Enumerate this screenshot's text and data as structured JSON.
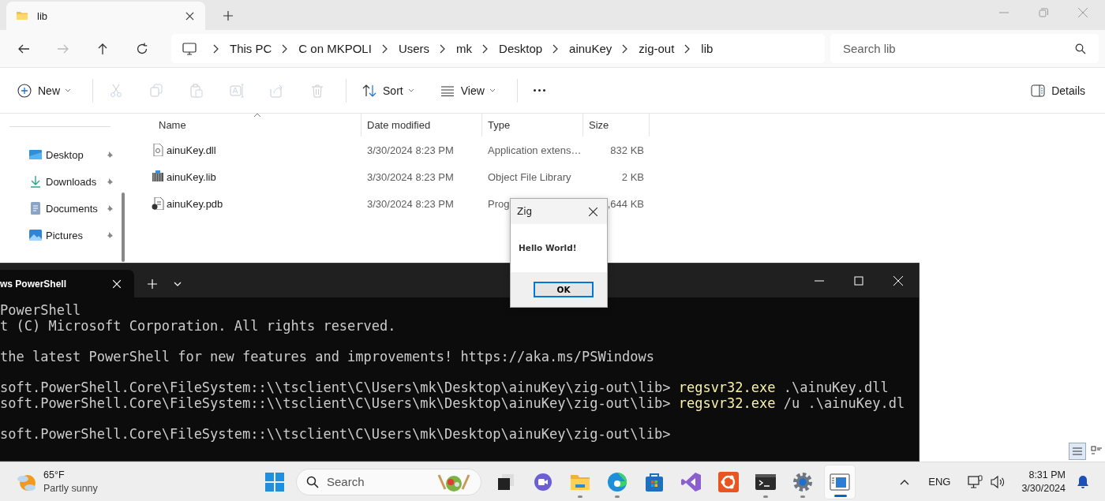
{
  "explorer": {
    "tab": {
      "title": "lib"
    },
    "breadcrumb": [
      "This PC",
      "C on MKPOLI",
      "Users",
      "mk",
      "Desktop",
      "ainuKey",
      "zig-out",
      "lib"
    ],
    "search": {
      "placeholder": "Search lib"
    },
    "toolbar": [
      {
        "kind": "new",
        "label": "New"
      }
    ],
    "edit_actions": [
      {
        "kind": "cut",
        "disabled": true
      },
      {
        "kind": "copy",
        "disabled": true
      },
      {
        "kind": "paste",
        "disabled": true
      },
      {
        "kind": "rename",
        "disabled": true
      },
      {
        "kind": "share",
        "disabled": true
      },
      {
        "kind": "delete",
        "disabled": true
      }
    ],
    "arrange_actions": [
      {
        "kind": "sort",
        "label": "Sort"
      },
      {
        "kind": "view",
        "label": "View"
      },
      {
        "kind": "more"
      }
    ],
    "details_button": "Details",
    "sidebar": [
      {
        "kind": "desktop",
        "label": "Desktop"
      },
      {
        "kind": "downloads",
        "label": "Downloads"
      },
      {
        "kind": "documents",
        "label": "Documents"
      },
      {
        "kind": "pictures",
        "label": "Pictures"
      }
    ],
    "columns": [
      "Name",
      "Date modified",
      "Type",
      "Size"
    ],
    "files": [
      {
        "kind": "dll",
        "name": "ainuKey.dll",
        "date": "3/30/2024 8:23 PM",
        "type": "Application extens…",
        "size": "832 KB"
      },
      {
        "kind": "lib",
        "name": "ainuKey.lib",
        "date": "3/30/2024 8:23 PM",
        "type": "Object File Library",
        "size": "2 KB"
      },
      {
        "kind": "pdb",
        "name": "ainuKey.pdb",
        "date": "3/30/2024 8:23 PM",
        "type": "Prog",
        "size": ",644 KB"
      }
    ],
    "view_modes": [
      {
        "kind": "details",
        "selected": true
      },
      {
        "kind": "tiles",
        "selected": false
      }
    ]
  },
  "terminal": {
    "tab": "ws PowerShell",
    "lines": [
      {
        "kind": "text",
        "text": "PowerShell"
      },
      {
        "kind": "text",
        "text": "t (C) Microsoft Corporation. All rights reserved."
      },
      {
        "kind": "blank"
      },
      {
        "kind": "text",
        "text": "the latest PowerShell for new features and improvements! https://aka.ms/PSWindows"
      },
      {
        "kind": "blank"
      },
      {
        "kind": "command",
        "prompt": "soft.PowerShell.Core\\FileSystem::\\\\tsclient\\C\\Users\\mk\\Desktop\\ainuKey\\zig-out\\lib>",
        "command": "regsvr32.exe",
        "args": ".\\ainuKey.dll"
      },
      {
        "kind": "command",
        "prompt": "soft.PowerShell.Core\\FileSystem::\\\\tsclient\\C\\Users\\mk\\Desktop\\ainuKey\\zig-out\\lib>",
        "command": "regsvr32.exe",
        "args": "/u .\\ainuKey.dl"
      },
      {
        "kind": "blank"
      },
      {
        "kind": "prompt",
        "prompt": "soft.PowerShell.Core\\FileSystem::\\\\tsclient\\C\\Users\\mk\\Desktop\\ainuKey\\zig-out\\lib>"
      }
    ]
  },
  "dialog": {
    "title": "Zig",
    "message": "Hello World!",
    "button": "OK"
  },
  "taskbar": {
    "weather": {
      "temperature": "65°F",
      "condition": "Partly sunny"
    },
    "search": {
      "placeholder": "Search"
    },
    "apps": [
      {
        "kind": "taskview",
        "running": false,
        "selected": false
      },
      {
        "kind": "chat",
        "running": false,
        "selected": false
      },
      {
        "kind": "explorer",
        "running": true,
        "selected": false
      },
      {
        "kind": "edge",
        "running": true,
        "selected": false
      },
      {
        "kind": "store",
        "running": false,
        "selected": false
      },
      {
        "kind": "studio",
        "running": false,
        "selected": false
      },
      {
        "kind": "ubuntu",
        "running": false,
        "selected": false
      },
      {
        "kind": "terminal",
        "running": true,
        "selected": false
      },
      {
        "kind": "settings",
        "running": true,
        "selected": false
      },
      {
        "kind": "preview",
        "running": true,
        "selected": true
      }
    ],
    "tray": {
      "language": "ENG",
      "time": "8:31 PM",
      "date": "3/30/2024"
    }
  }
}
